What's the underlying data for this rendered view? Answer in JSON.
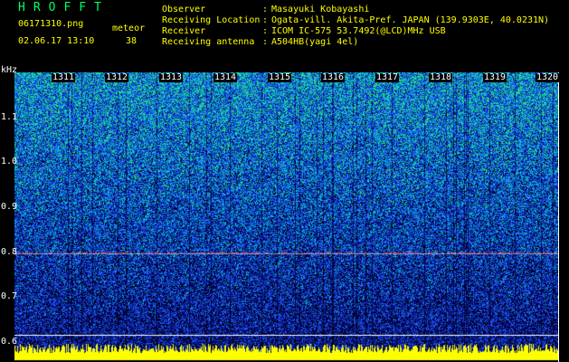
{
  "header": {
    "app_title": "HROFFT",
    "filename": "06171310.png",
    "datetime": "02.06.17 13:10",
    "meteor_label": "meteor",
    "meteor_count": "38"
  },
  "station_info": [
    {
      "key": "Observer",
      "value": "Masayuki Kobayashi"
    },
    {
      "key": "Receiving Location",
      "value": "Ogata-vill. Akita-Pref. JAPAN (139.9303E, 40.0231N)"
    },
    {
      "key": "Receiver",
      "value": "ICOM IC-575 53.7492(@LCD)MHz USB"
    },
    {
      "key": "Receiving antenna",
      "value": "A504HB(yagi 4el)"
    }
  ],
  "spectrogram": {
    "y_unit": "kHz",
    "y_ticks": [
      "1.1",
      "1.0",
      "0.9",
      "0.8",
      "0.7",
      "0.6"
    ],
    "x_ticks": [
      "1311",
      "1312",
      "1313",
      "1314",
      "1315",
      "1316",
      "1317",
      "1318",
      "1319",
      "1320"
    ],
    "colors": {
      "background": "#000000",
      "noise_low": "#0a1a9a",
      "noise_mid": "#1f6bff",
      "noise_high": "#00d0c0",
      "carrier": "#ff4040",
      "level_bar": "#ffff00"
    }
  }
}
